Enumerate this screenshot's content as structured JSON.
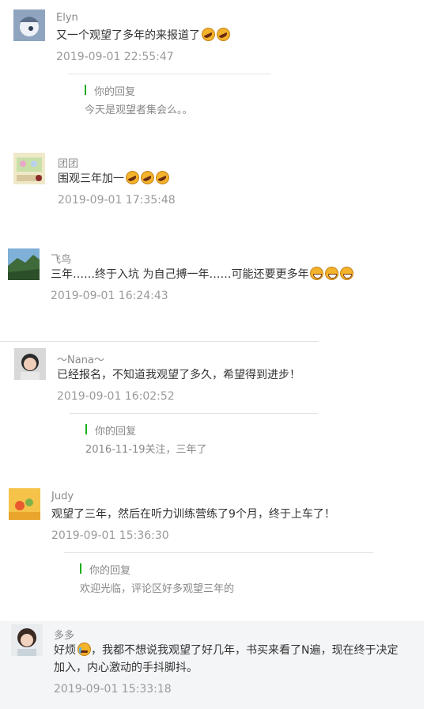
{
  "comments": [
    {
      "name": "Elyn",
      "text": "又一个观望了多年的来报道了",
      "emojis": [
        "laugh-icon",
        "laugh-icon"
      ],
      "time": "2019-09-01 22:55:47",
      "reply_label": "你的回复",
      "reply_text": "今天是观望者集会么。。"
    },
    {
      "name": "团团",
      "text": "围观三年加一",
      "emojis": [
        "laugh-icon",
        "laugh-icon",
        "laugh-icon"
      ],
      "time": "2019-09-01 17:35:48"
    },
    {
      "name": "飞鸟",
      "text": "三年……终于入坑 为自己搏一年……可能还要更多年",
      "emojis": [
        "grin-icon",
        "grin-icon",
        "grin-icon"
      ],
      "time": "2019-09-01 16:24:43"
    },
    {
      "name": "～Nana～",
      "text": "已经报名，不知道我观望了多久，希望得到进步！",
      "time": "2019-09-01 16:02:52",
      "reply_label": "你的回复",
      "reply_text": "2016-11-19关注，三年了"
    },
    {
      "name": "Judy",
      "text": "观望了三年，然后在听力训练营练了9个月，终于上车了！",
      "time": "2019-09-01 15:36:30",
      "reply_label": "你的回复",
      "reply_text": "欢迎光临，评论区好多观望三年的"
    },
    {
      "name": "多多",
      "text_prefix": "好烦",
      "emojis": [
        "cry-icon"
      ],
      "text_line1": "，我都不想说我观望了好几年，书买来看了N遍，现在终于决定",
      "text_line2": "加入，内心激动的手抖脚抖。",
      "time": "2019-09-01 15:33:18"
    }
  ],
  "colors": {
    "reply_accent": "#1aad19",
    "time": "#9a9a9a",
    "name": "#888888",
    "highlight_bg": "#f4f5f7"
  }
}
